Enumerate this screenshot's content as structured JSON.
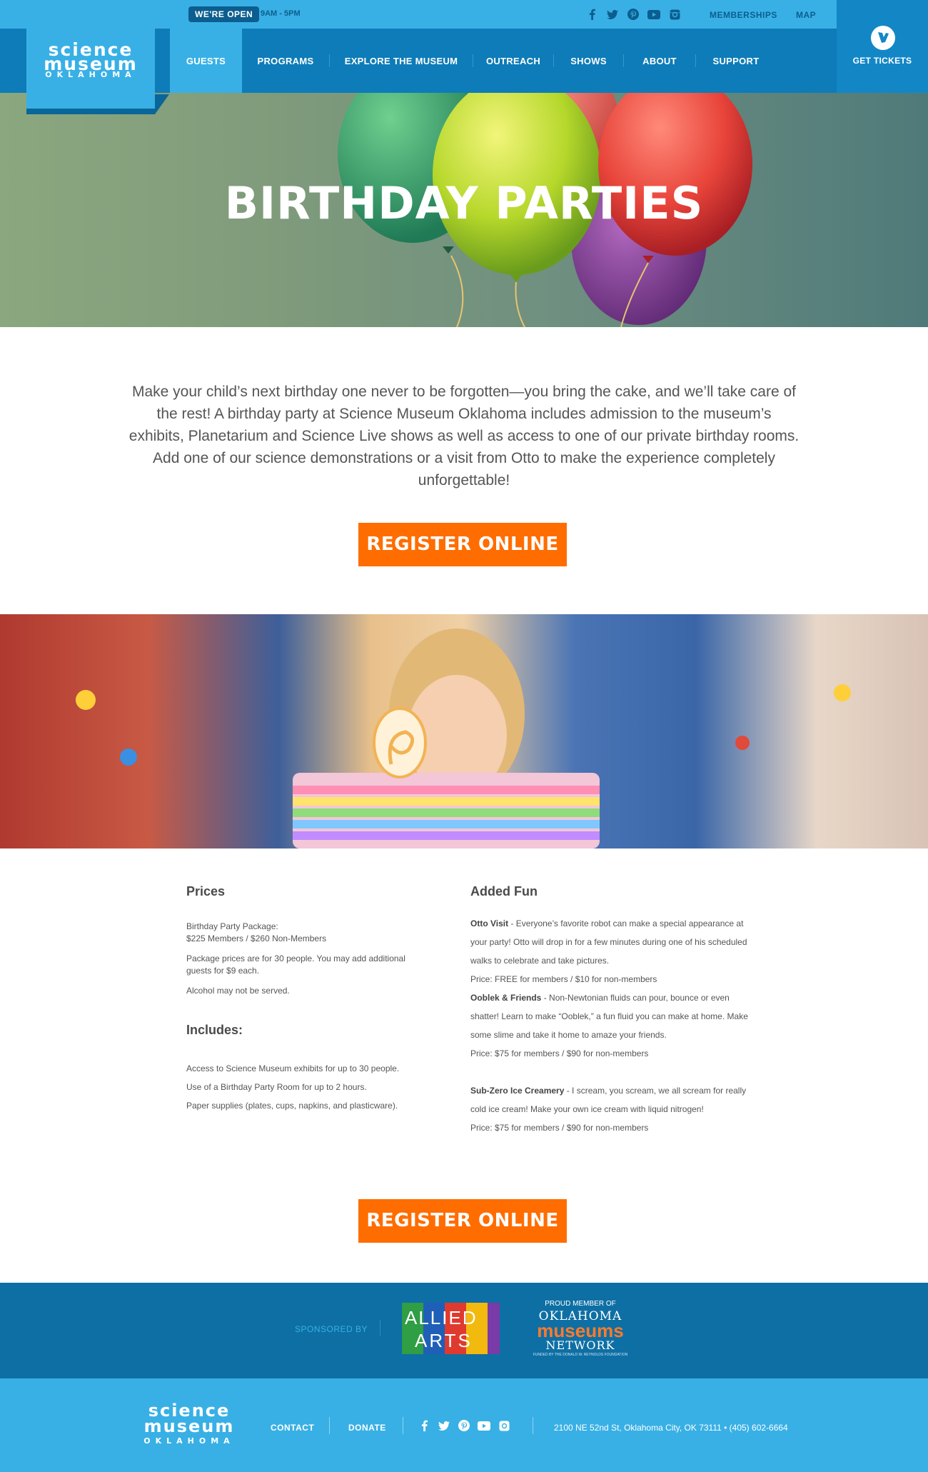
{
  "header": {
    "open_badge": "WE'RE OPEN",
    "hours": "9AM - 5PM",
    "top_links": [
      "MEMBERSHIPS",
      "MAP"
    ],
    "logo": {
      "line1": "science",
      "line2": "museum",
      "line3": "OKLAHOMA"
    },
    "social": [
      "facebook-icon",
      "twitter-icon",
      "pinterest-icon",
      "youtube-icon",
      "instagram-icon"
    ],
    "nav": [
      "GUESTS",
      "PROGRAMS",
      "EXPLORE THE MUSEUM",
      "OUTREACH",
      "SHOWS",
      "ABOUT",
      "SUPPORT"
    ],
    "active_nav": "GUESTS",
    "tickets_label": "GET TICKETS"
  },
  "hero": {
    "title": "BIRTHDAY PARTIES"
  },
  "intro": {
    "text": "Make your child’s next birthday one never to be forgotten—you bring the cake, and we’ll take care of the rest! A birthday party at Science Museum Oklahoma includes admission to the museum’s exhibits, Planetarium and Science Live shows as well as access to one of our private birthday rooms. Add one of our science demonstrations or a visit from Otto to make the experience completely unforgettable!",
    "register_label": "REGISTER ONLINE"
  },
  "prices": {
    "heading": "Prices",
    "package_label": "Birthday Party Package:",
    "package_price": "$225 Members / $260 Non-Members",
    "note": "Package prices are for 30 people. You may add additional guests for $9 each.",
    "alcohol": "Alcohol may not be served.",
    "includes_heading": "Includes:",
    "includes": [
      "Access to Science Museum exhibits for up to 30 people.",
      "Use of a Birthday Party Room for up to 2 hours.",
      "Paper supplies (plates, cups, napkins, and plasticware)."
    ]
  },
  "added_fun": {
    "heading": "Added Fun",
    "otto_title": "Otto Visit",
    "otto_text": " - Everyone’s favorite robot can make a special appearance at your party! Otto will drop in for a few minutes during one of his scheduled walks to celebrate and take pictures.",
    "otto_price": "Price: FREE for members / $10 for non-members",
    "ooblek_title": "Ooblek & Friends",
    "ooblek_text": " - Non-Newtonian fluids can pour, bounce or even shatter! Learn to make “Ooblek,” a fun fluid you can make at home. Make some slime and take it home to amaze your friends.",
    "ooblek_price": "Price: $75 for members / $90 for non-members",
    "ice_title": "Sub-Zero Ice Creamery",
    "ice_text": " - I scream, you scream, we all scream for really cold ice cream! Make your own ice cream with liquid nitrogen!",
    "ice_price": "Price: $75 for members /  $90 for non-members"
  },
  "register_bottom_label": "REGISTER ONLINE",
  "sponsor": {
    "label": "SPONSORED BY",
    "allied_top": "ALLIED",
    "allied_bottom": "ARTS",
    "omn_top": "PROUD MEMBER OF",
    "omn_line1": "OKLAHOMA",
    "omn_line2": "museums",
    "omn_line3": "NETWORK",
    "omn_small": "FUNDED BY THE DONALD W. REYNOLDS FOUNDATION"
  },
  "footer": {
    "logo": {
      "line1": "science",
      "line2": "museum",
      "line3": "OKLAHOMA"
    },
    "links": [
      "CONTACT",
      "DONATE"
    ],
    "address": "2100 NE 52nd St, Oklahoma City, OK 73111  • (405) 602-6664"
  },
  "colors": {
    "accent_blue": "#38b0e5",
    "dark_blue": "#0e7cb8",
    "orange": "#ff6d00"
  }
}
